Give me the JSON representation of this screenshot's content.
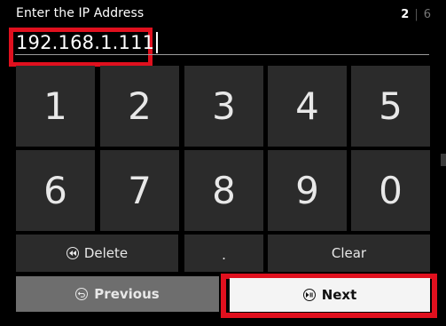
{
  "header": {
    "title": "Enter the IP Address",
    "step_current": "2",
    "step_separator": "|",
    "step_total": "6"
  },
  "ip_field": {
    "value": "192.168.1.111"
  },
  "keypad": {
    "digits": [
      "1",
      "2",
      "3",
      "4",
      "5",
      "6",
      "7",
      "8",
      "9",
      "0"
    ],
    "delete_label": "Delete",
    "dot_label": ".",
    "clear_label": "Clear"
  },
  "nav": {
    "previous_label": "Previous",
    "next_label": "Next"
  },
  "icons": {
    "delete": "rewind-circle-icon",
    "previous": "back-circle-icon",
    "next": "play-pause-circle-icon"
  },
  "colors": {
    "background": "#000000",
    "key": "#2b2b2b",
    "highlight": "#e0101e",
    "previous_button": "#6e6e6e",
    "next_button": "#f4f4f4"
  }
}
